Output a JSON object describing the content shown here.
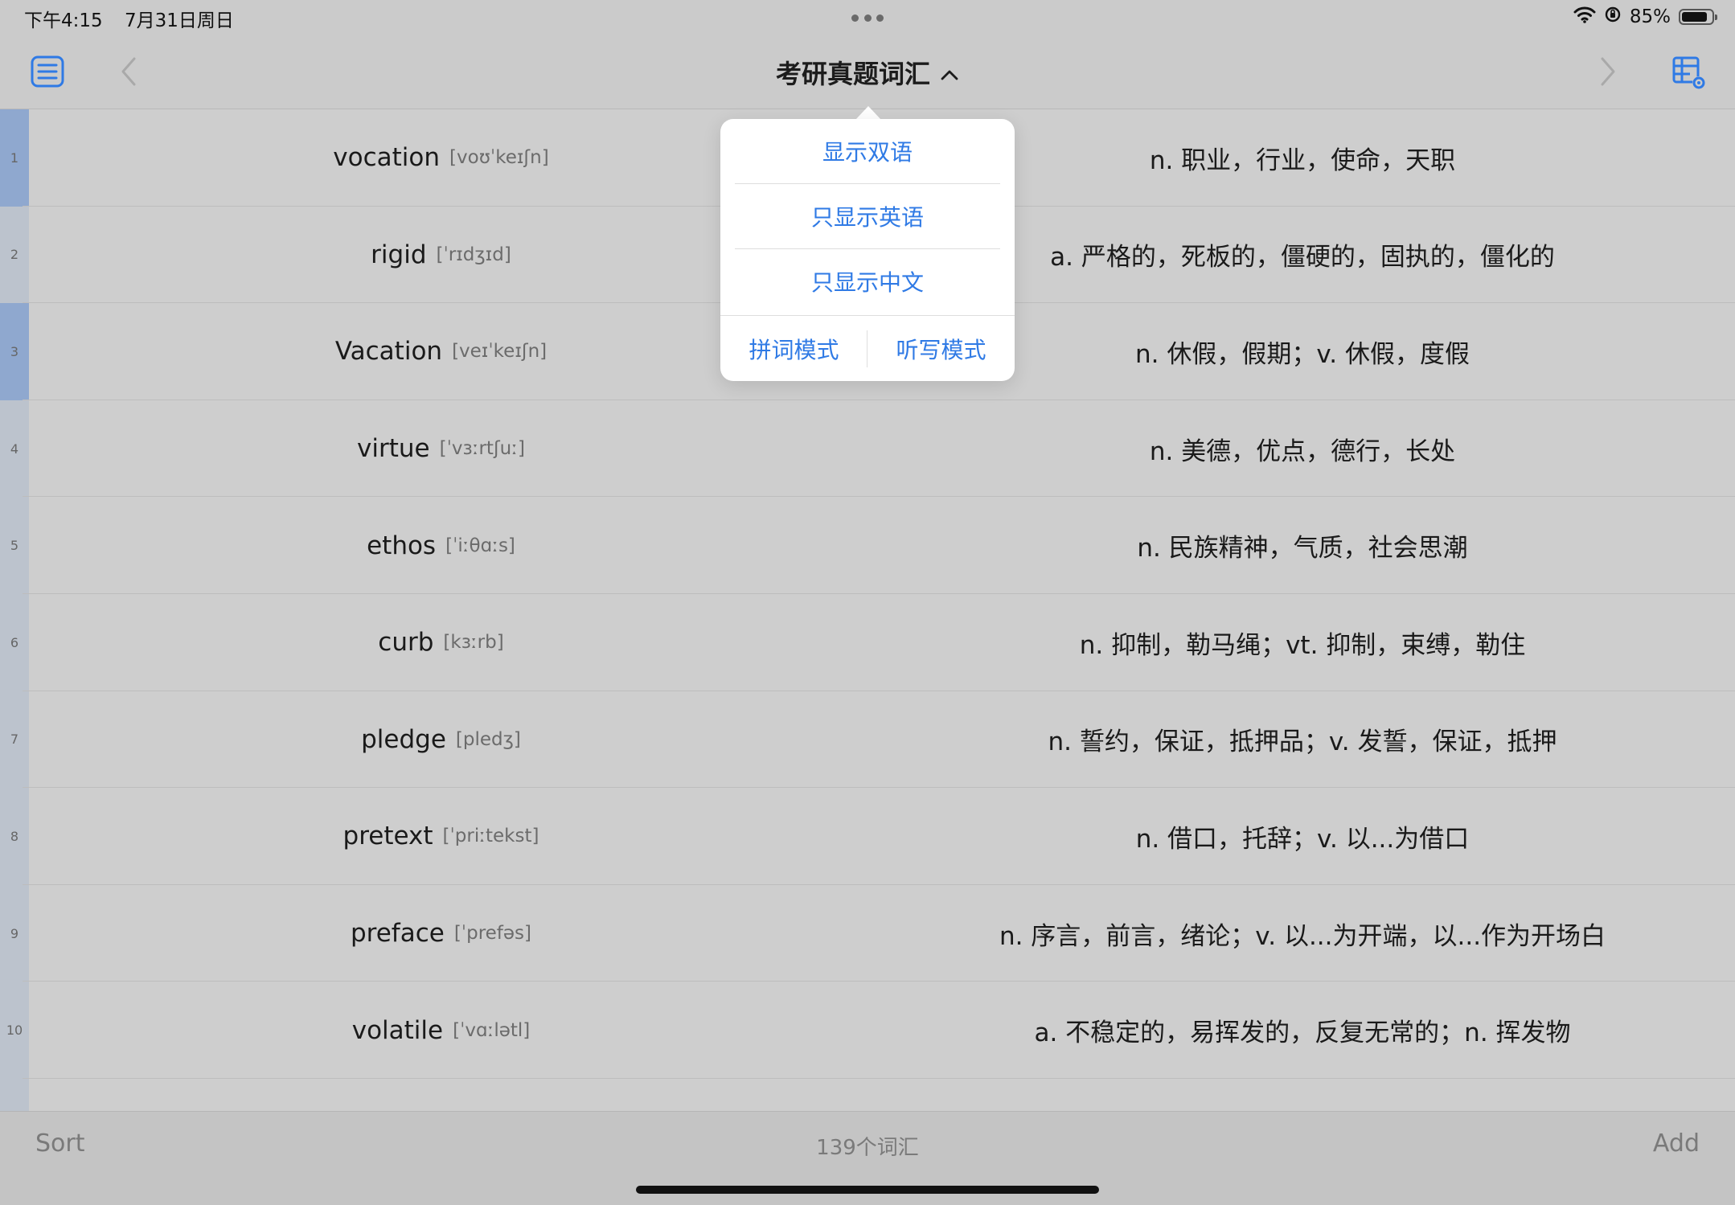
{
  "status_bar": {
    "time": "下午4:15",
    "date": "7月31日周日",
    "battery_percent": "85%",
    "battery_level": 0.85
  },
  "nav": {
    "title": "考研真题词汇",
    "title_chevron_icon": "chevron-up-icon",
    "left_icons": [
      "list-icon",
      "chevron-left-icon"
    ],
    "right_icons": [
      "chevron-right-icon",
      "table-settings-icon"
    ]
  },
  "words": [
    {
      "index": "1",
      "word": "vocation",
      "phonetic": "[voʊˈkeɪʃn]",
      "meaning": "n. 职业，行业，使命，天职",
      "highlight": true
    },
    {
      "index": "2",
      "word": "rigid",
      "phonetic": "[ˈrɪdʒɪd]",
      "meaning": "a. 严格的，死板的，僵硬的，固执的，僵化的",
      "highlight": false
    },
    {
      "index": "3",
      "word": "Vacation",
      "phonetic": "[veɪˈkeɪʃn]",
      "meaning": "n. 休假，假期；v. 休假，度假",
      "highlight": true
    },
    {
      "index": "4",
      "word": "virtue",
      "phonetic": "[ˈvɜːrtʃuː]",
      "meaning": "n. 美德，优点，德行，长处",
      "highlight": false
    },
    {
      "index": "5",
      "word": "ethos",
      "phonetic": "[ˈiːθɑːs]",
      "meaning": "n. 民族精神，气质，社会思潮",
      "highlight": false
    },
    {
      "index": "6",
      "word": "curb",
      "phonetic": "[kɜːrb]",
      "meaning": "n. 抑制，勒马绳；vt. 抑制，束缚，勒住",
      "highlight": false
    },
    {
      "index": "7",
      "word": "pledge",
      "phonetic": "[pledʒ]",
      "meaning": "n. 誓约，保证，抵押品；v. 发誓，保证，抵押",
      "highlight": false
    },
    {
      "index": "8",
      "word": "pretext",
      "phonetic": "[ˈpriːtekst]",
      "meaning": "n. 借口，托辞；v. 以...为借口",
      "highlight": false
    },
    {
      "index": "9",
      "word": "preface",
      "phonetic": "[ˈprefəs]",
      "meaning": "n. 序言，前言，绪论；v. 以...为开端，以...作为开场白",
      "highlight": false
    },
    {
      "index": "10",
      "word": "volatile",
      "phonetic": "[ˈvɑːlətl]",
      "meaning": "a. 不稳定的，易挥发的，反复无常的；n. 挥发物",
      "highlight": false
    }
  ],
  "popover": {
    "show_both": "显示双语",
    "show_english": "只显示英语",
    "show_chinese": "只显示中文",
    "spell_mode": "拼词模式",
    "dictation_mode": "听写模式"
  },
  "toolbar": {
    "sort_label": "Sort",
    "count_label": "139个词汇",
    "add_label": "Add"
  },
  "colors": {
    "accent": "#2f7ae5",
    "highlight_strong": "#8fa8cf",
    "highlight_light": "#bcc3cd"
  }
}
